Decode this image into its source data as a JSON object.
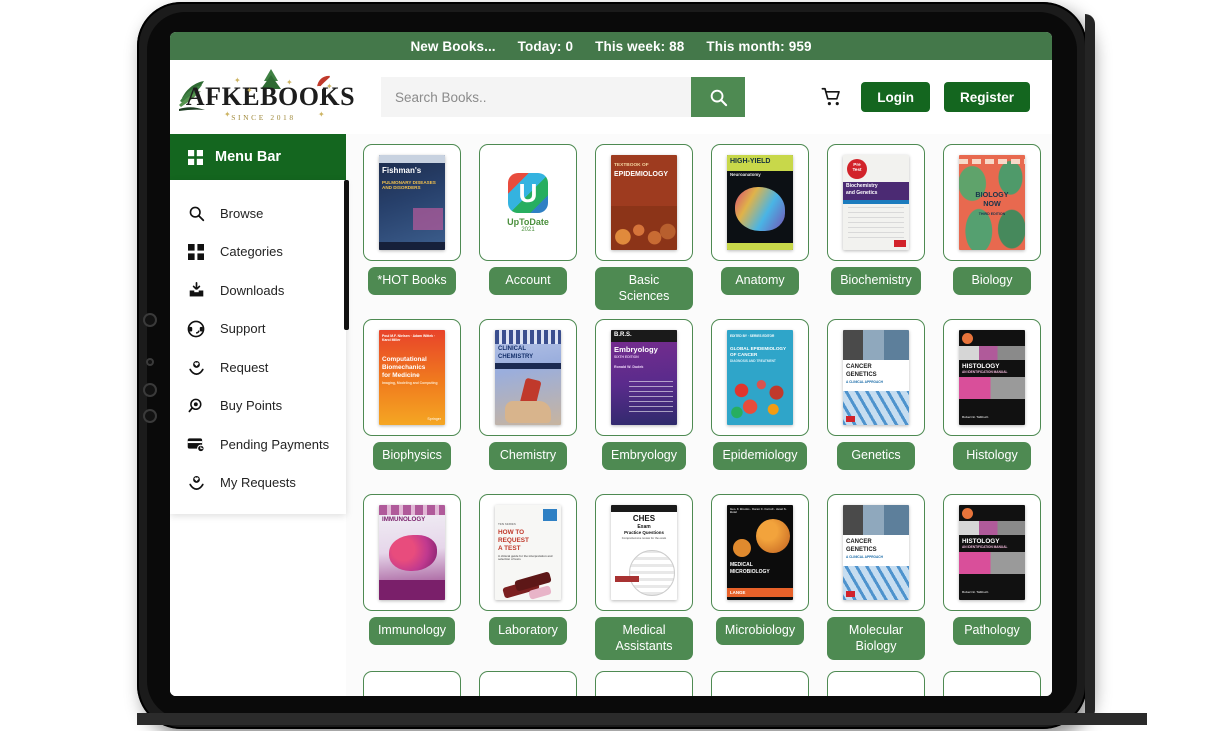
{
  "notice_bar": {
    "label": "New Books...",
    "stats": [
      {
        "name": "Today:",
        "value": "0"
      },
      {
        "name": "This week:",
        "value": "88"
      },
      {
        "name": "This month:",
        "value": "959"
      }
    ]
  },
  "header": {
    "logo_word": "AFKEBOOKS",
    "logo_since": "SINCE 2018",
    "search_placeholder": "Search Books..",
    "search_value": "",
    "search_icon": "search-icon",
    "cart_icon": "shopping-cart-icon",
    "login_label": "Login",
    "register_label": "Register"
  },
  "sidebar": {
    "header_label": "Menu Bar",
    "header_icon": "grid-squares-icon",
    "items": [
      {
        "label": "Browse",
        "icon": "search-icon"
      },
      {
        "label": "Categories",
        "icon": "grid-squares-icon"
      },
      {
        "label": "Downloads",
        "icon": "download-box-icon"
      },
      {
        "label": "Support",
        "icon": "headset-icon"
      },
      {
        "label": "Request",
        "icon": "hand-heart-icon"
      },
      {
        "label": "Buy Points",
        "icon": "coin-magnifier-icon"
      },
      {
        "label": "Pending Payments",
        "icon": "card-clock-icon"
      },
      {
        "label": "My Requests",
        "icon": "hand-heart-icon"
      }
    ]
  },
  "colors": {
    "notice_green": "#44784a",
    "dark_green": "#14661f",
    "pill_green": "#4e8a52",
    "page_bg": "#fbfbfb"
  },
  "categories": [
    {
      "label": "*HOT Books",
      "cover_title": "Fishman's",
      "cover_sub": "PULMONARY DISEASES AND DISORDERS"
    },
    {
      "label": "Account",
      "cover_title": "UpToDate",
      "cover_sub": "2021"
    },
    {
      "label": "Basic Sciences",
      "cover_title": "TEXTBOOK OF EPIDEMIOLOGY",
      "cover_sub": ""
    },
    {
      "label": "Anatomy",
      "cover_title": "HIGH-YIELD",
      "cover_sub": "Neuroanatomy"
    },
    {
      "label": "Biochemistry",
      "cover_title": "Biochemistry and Genetics",
      "cover_sub": "PreTest"
    },
    {
      "label": "Biology",
      "cover_title": "BIOLOGY NOW",
      "cover_sub": ""
    },
    {
      "label": "Biophysics",
      "cover_title": "Computational Biomechanics for Medicine",
      "cover_sub": ""
    },
    {
      "label": "Chemistry",
      "cover_title": "CLINICAL CHEMISTRY",
      "cover_sub": ""
    },
    {
      "label": "Embryology",
      "cover_title": "Embryology",
      "cover_sub": "BRS"
    },
    {
      "label": "Epidemiology",
      "cover_title": "GLOBAL EPIDEMIOLOGY OF CANCER",
      "cover_sub": ""
    },
    {
      "label": "Genetics",
      "cover_title": "CANCER GENETICS",
      "cover_sub": "A CLINICAL APPROACH"
    },
    {
      "label": "Histology",
      "cover_title": "HISTOLOGY",
      "cover_sub": "AN IDENTIFICATION MANUAL"
    },
    {
      "label": "Immunology",
      "cover_title": "IMMUNOLOGY",
      "cover_sub": ""
    },
    {
      "label": "Laboratory",
      "cover_title": "HOW TO REQUEST A TEST",
      "cover_sub": ""
    },
    {
      "label": "Medical Assistants",
      "cover_title": "CHES",
      "cover_sub": "Exam Practice Questions"
    },
    {
      "label": "Microbiology",
      "cover_title": "MEDICAL MICROBIOLOGY",
      "cover_sub": "LANGE"
    },
    {
      "label": "Molecular Biology",
      "cover_title": "CANCER GENETICS",
      "cover_sub": "A CLINICAL APPROACH"
    },
    {
      "label": "Pathology",
      "cover_title": "HISTOLOGY",
      "cover_sub": "AN IDENTIFICATION MANUAL"
    }
  ]
}
